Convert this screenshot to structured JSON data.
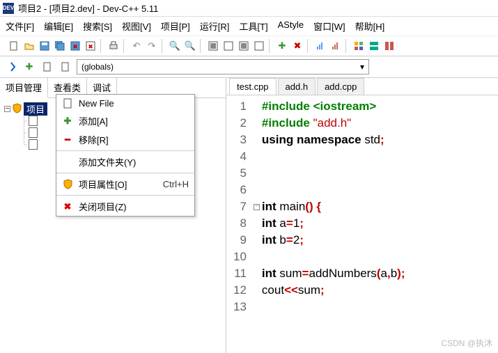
{
  "title": "项目2 - [项目2.dev] - Dev-C++ 5.11",
  "menus": [
    "文件[F]",
    "编辑[E]",
    "搜索[S]",
    "视图[V]",
    "项目[P]",
    "运行[R]",
    "工具[T]",
    "AStyle",
    "窗口[W]",
    "帮助[H]"
  ],
  "globals_select": "(globals)",
  "side_tabs": [
    "项目管理",
    "查看类",
    "调试"
  ],
  "project_root": "项目",
  "editor_tabs": [
    "test.cpp",
    "add.h",
    "add.cpp"
  ],
  "active_editor_tab": 0,
  "context_menu": {
    "new_file": "New File",
    "add": "添加[A]",
    "remove": "移除[R]",
    "add_folder": "添加文件夹(Y)",
    "properties": "项目属性[O]",
    "properties_shortcut": "Ctrl+H",
    "close": "关闭项目(Z)"
  },
  "code": {
    "line_count": 13,
    "fold_line": 7,
    "l1_a": "#include ",
    "l1_b": "<iostream>",
    "l2_a": "#include ",
    "l2_b": "\"add.h\"",
    "l3_a": "using",
    "l3_b": " namespace",
    "l3_c": " std",
    "l3_d": ";",
    "l7_a": "int",
    "l7_b": " main",
    "l7_c": "()",
    "l7_d": " {",
    "l8_a": "int",
    "l8_b": " a",
    "l8_c": "=",
    "l8_d": "1",
    "l8_e": ";",
    "l9_a": "int",
    "l9_b": " b",
    "l9_c": "=",
    "l9_d": "2",
    "l9_e": ";",
    "l11_a": "int",
    "l11_b": " sum",
    "l11_c": "=",
    "l11_d": "addNumbers",
    "l11_e": "(",
    "l11_f": "a",
    "l11_g": ",",
    "l11_h": "b",
    "l11_i": ");",
    "l12_a": "cout",
    "l12_b": "<<",
    "l12_c": "sum",
    "l12_d": ";"
  },
  "watermark": "CSDN @执沐"
}
